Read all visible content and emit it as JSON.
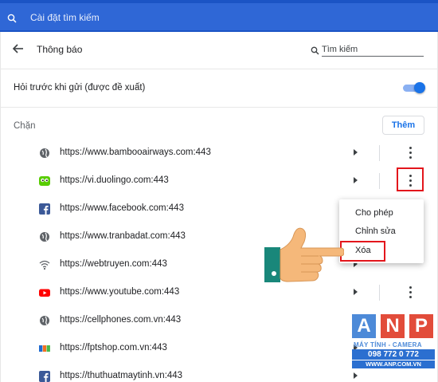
{
  "topbar": {
    "search_label": "Cài đặt tìm kiếm"
  },
  "header": {
    "title": "Thông báo",
    "filter_placeholder": "Tìm kiếm"
  },
  "ask_setting": {
    "label": "Hỏi trước khi gửi (được đề xuất)",
    "enabled": true
  },
  "block_section": {
    "label": "Chặn",
    "add_label": "Thêm"
  },
  "sites": [
    {
      "url": "https://www.bambooairways.com:443",
      "icon": "globe-icon"
    },
    {
      "url": "https://vi.duolingo.com:443",
      "icon": "duolingo-icon"
    },
    {
      "url": "https://www.facebook.com:443",
      "icon": "facebook-icon"
    },
    {
      "url": "https://www.tranbadat.com:443",
      "icon": "globe-icon"
    },
    {
      "url": "https://webtruyen.com:443",
      "icon": "webtruyen-icon"
    },
    {
      "url": "https://www.youtube.com:443",
      "icon": "youtube-icon"
    },
    {
      "url": "https://cellphones.com.vn:443",
      "icon": "globe-icon"
    },
    {
      "url": "https://fptshop.com.vn:443",
      "icon": "fpt-icon"
    },
    {
      "url": "https://thuthuatmaytinh.vn:443",
      "icon": "facebook-icon"
    }
  ],
  "context_menu": {
    "items": [
      "Cho phép",
      "Chỉnh sửa",
      "Xóa"
    ]
  },
  "watermark": {
    "letters": [
      "A",
      "N",
      "P"
    ],
    "tagline": "MÁY TÍNH - CAMERA",
    "phone": "098 772 0 772",
    "url": "WWW.ANP.COM.VN"
  },
  "colors": {
    "topbar": "#1b54c5",
    "accent": "#1a73e8",
    "highlight": "#e3161c"
  }
}
